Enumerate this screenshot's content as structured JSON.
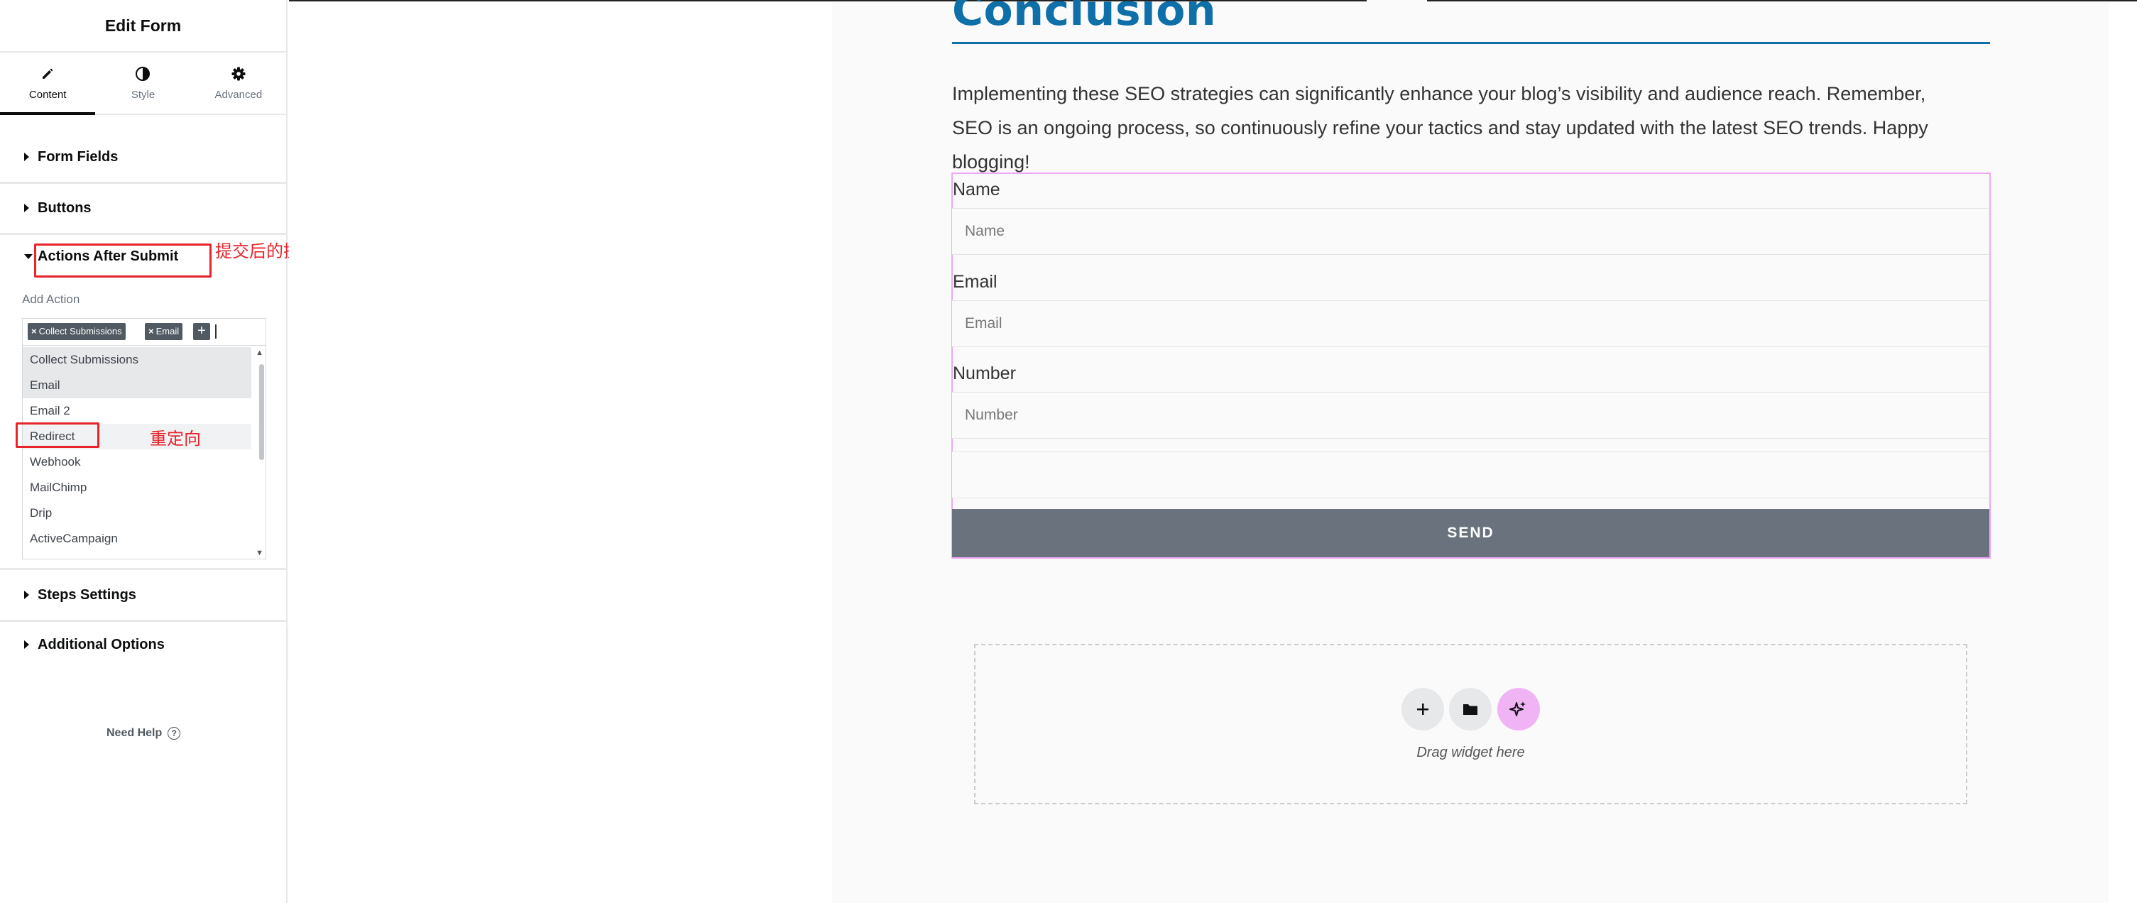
{
  "panel": {
    "title": "Edit Form",
    "tabs": [
      {
        "label": "Content",
        "icon": "pencil-icon",
        "active": true
      },
      {
        "label": "Style",
        "icon": "contrast-icon",
        "active": false
      },
      {
        "label": "Advanced",
        "icon": "gear-icon",
        "active": false
      }
    ],
    "sections": {
      "form_fields": "Form Fields",
      "buttons": "Buttons",
      "actions_after_submit": "Actions After Submit",
      "steps_settings": "Steps Settings",
      "additional_options": "Additional Options"
    },
    "add_action_label": "Add Action",
    "selected_actions": [
      "Collect Submissions",
      "Email"
    ],
    "chip_remove_symbol": "×",
    "chip_add_symbol": "+",
    "action_options": [
      "Collect Submissions",
      "Email",
      "Email 2",
      "Redirect",
      "Webhook",
      "MailChimp",
      "Drip",
      "ActiveCampaign"
    ],
    "need_help": "Need Help",
    "help_symbol": "?",
    "collapse_symbol": "‹"
  },
  "annotations": {
    "actions_after_submit_note": "提交后的操作",
    "redirect_note": "重定向",
    "color": "#e8232a"
  },
  "canvas": {
    "heading": "Conclusion",
    "paragraph": "Implementing these SEO strategies can significantly enhance your blog’s visibility and audience reach. Remember, SEO is an ongoing process, so continuously refine your tactics and stay updated with the latest SEO trends. Happy blogging!",
    "form": {
      "fields": [
        {
          "label": "Name",
          "placeholder": "Name"
        },
        {
          "label": "Email",
          "placeholder": "Email"
        },
        {
          "label": "Number",
          "placeholder": "Number"
        }
      ],
      "send_label": "SEND"
    },
    "drop_zone": {
      "text": "Drag widget here",
      "buttons": [
        "plus-icon",
        "folder-icon",
        "ai-sparkle-icon"
      ]
    }
  },
  "colors": {
    "heading": "#0f6fa8",
    "send_button": "#69727d",
    "form_outline": "#f0a8f5",
    "ai_button": "#f0b4f5"
  }
}
